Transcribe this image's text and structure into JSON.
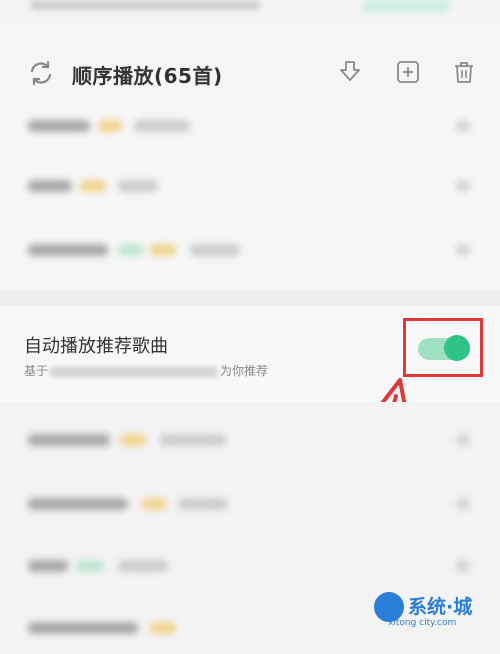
{
  "header": {
    "title": "顺序播放(65首)",
    "icons": [
      "loop-icon",
      "download-icon",
      "add-icon",
      "trash-icon"
    ]
  },
  "autoplay": {
    "title": "自动播放推荐歌曲",
    "desc_prefix": "基于",
    "desc_suffix": "为你推荐",
    "toggle_on": true,
    "accent_color": "#2fc486"
  },
  "annotation": {
    "box_color": "#e03838"
  },
  "watermark": {
    "text": "系统·城",
    "url": "xitong city.com"
  }
}
